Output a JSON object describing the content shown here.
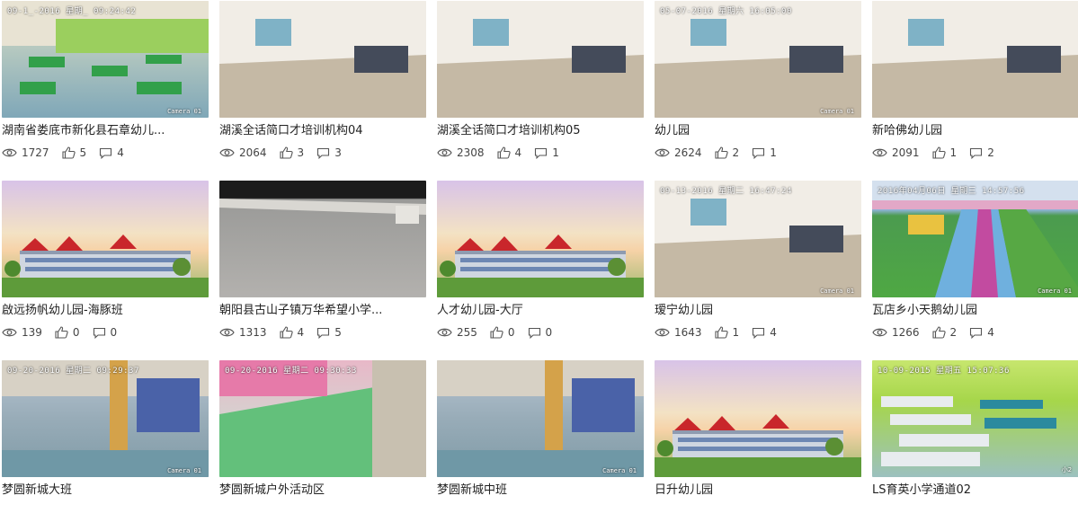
{
  "cards": [
    {
      "title": "湖南省娄底市新化县石章幼儿...",
      "views": "1727",
      "likes": "5",
      "comments": "4",
      "scene": "classroom",
      "timestamp": "09-1_-2016 星期_ 09:24:42",
      "camera": "Camera 01"
    },
    {
      "title": "湖溪全话简口才培训机构04",
      "views": "2064",
      "likes": "3",
      "comments": "3",
      "scene": "room",
      "timestamp": "",
      "camera": ""
    },
    {
      "title": "湖溪全话简口才培训机构05",
      "views": "2308",
      "likes": "4",
      "comments": "1",
      "scene": "room",
      "timestamp": "",
      "camera": ""
    },
    {
      "title": "幼儿园",
      "views": "2624",
      "likes": "2",
      "comments": "1",
      "scene": "room",
      "timestamp": "05-07-2016 星期六 16:05:00",
      "camera": "Camera 01"
    },
    {
      "title": "新哈佛幼儿园",
      "views": "2091",
      "likes": "1",
      "comments": "2",
      "scene": "room",
      "timestamp": "",
      "camera": ""
    },
    {
      "title": "啟远扬帆幼儿园-海豚班",
      "views": "139",
      "likes": "0",
      "comments": "0",
      "scene": "building",
      "timestamp": "",
      "camera": ""
    },
    {
      "title": "朝阳县古山子镇万华希望小学...",
      "views": "1313",
      "likes": "4",
      "comments": "5",
      "scene": "roof",
      "timestamp": "",
      "camera": ""
    },
    {
      "title": "人才幼儿园-大厅",
      "views": "255",
      "likes": "0",
      "comments": "0",
      "scene": "building",
      "timestamp": "",
      "camera": ""
    },
    {
      "title": "瑷宁幼儿园",
      "views": "1643",
      "likes": "1",
      "comments": "4",
      "scene": "room",
      "timestamp": "09-13-2016 星期二 16:47:24",
      "camera": "Camera 01"
    },
    {
      "title": "瓦店乡小天鹅幼儿园",
      "views": "1266",
      "likes": "2",
      "comments": "4",
      "scene": "playground",
      "timestamp": "2016年04月06日 星期三 14:57:56",
      "camera": "Camera 01"
    },
    {
      "title": "梦圆新城大班",
      "views": "",
      "likes": "",
      "comments": "",
      "scene": "hall",
      "timestamp": "09-20-2016 星期二 09:29:37",
      "camera": "Camera 01"
    },
    {
      "title": "梦圆新城户外活动区",
      "views": "",
      "likes": "",
      "comments": "",
      "scene": "pink",
      "timestamp": "09-20-2016 星期二 09:30:33",
      "camera": ""
    },
    {
      "title": "梦圆新城中班",
      "views": "",
      "likes": "",
      "comments": "",
      "scene": "hall",
      "timestamp": "",
      "camera": "Camera 01"
    },
    {
      "title": "日升幼儿园",
      "views": "",
      "likes": "",
      "comments": "",
      "scene": "building",
      "timestamp": "",
      "camera": ""
    },
    {
      "title": "LS育英小学通道02",
      "views": "",
      "likes": "",
      "comments": "",
      "scene": "green",
      "timestamp": "10-09-2015 星期五 15:07:36",
      "camera": "小2"
    }
  ]
}
